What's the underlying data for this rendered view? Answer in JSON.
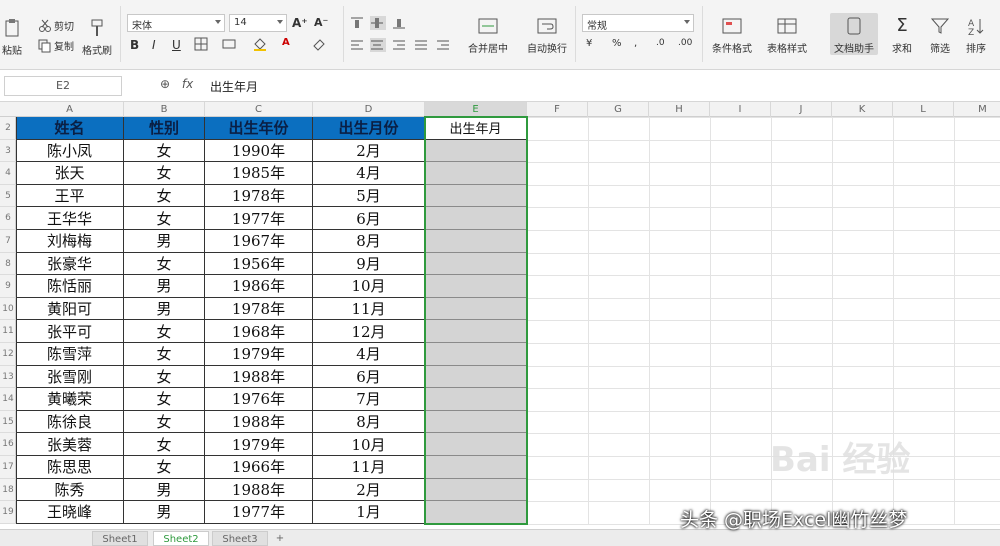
{
  "ribbon": {
    "paste": "粘贴",
    "cut": "剪切",
    "copy": "复制",
    "format_painter": "格式刷",
    "font_name": "宋体",
    "font_size": "14",
    "merge_center": "合并居中",
    "wrap_text": "自动换行",
    "number_format": "常规",
    "conditional_format": "条件格式",
    "table_style": "表格样式",
    "doc_helper": "文档助手",
    "sum": "求和",
    "filter": "筛选",
    "sort": "排序"
  },
  "formula_bar": {
    "name_box": "E2",
    "fx": "fx",
    "value": "出生年月"
  },
  "columns": [
    "A",
    "B",
    "C",
    "D",
    "E",
    "F",
    "G",
    "H",
    "I",
    "J",
    "K",
    "L",
    "M"
  ],
  "rows": [
    "2",
    "3",
    "4",
    "5",
    "6",
    "7",
    "8",
    "9",
    "10",
    "11",
    "12",
    "13",
    "14",
    "15",
    "16",
    "17",
    "18",
    "19"
  ],
  "table": {
    "headers": [
      "姓名",
      "性别",
      "出生年份",
      "出生月份",
      "出生年月"
    ],
    "rows": [
      [
        "陈小凤",
        "女",
        "1990年",
        "2月"
      ],
      [
        "张天",
        "女",
        "1985年",
        "4月"
      ],
      [
        "王平",
        "女",
        "1978年",
        "5月"
      ],
      [
        "王华华",
        "女",
        "1977年",
        "6月"
      ],
      [
        "刘梅梅",
        "男",
        "1967年",
        "8月"
      ],
      [
        "张豪华",
        "女",
        "1956年",
        "9月"
      ],
      [
        "陈恬丽",
        "男",
        "1986年",
        "10月"
      ],
      [
        "黄阳可",
        "男",
        "1978年",
        "11月"
      ],
      [
        "张平可",
        "女",
        "1968年",
        "12月"
      ],
      [
        "陈雪萍",
        "女",
        "1979年",
        "4月"
      ],
      [
        "张雪刚",
        "女",
        "1988年",
        "6月"
      ],
      [
        "黄曦荣",
        "女",
        "1976年",
        "7月"
      ],
      [
        "陈徐良",
        "女",
        "1988年",
        "8月"
      ],
      [
        "张美蓉",
        "女",
        "1979年",
        "10月"
      ],
      [
        "陈思思",
        "女",
        "1966年",
        "11月"
      ],
      [
        "陈秀",
        "男",
        "1988年",
        "2月"
      ],
      [
        "王晓峰",
        "男",
        "1977年",
        "1月"
      ]
    ]
  },
  "sheets": [
    "Sheet1",
    "Sheet2",
    "Sheet3"
  ],
  "active_sheet": "Sheet2",
  "add_sheet": "+",
  "watermark": "头条 @职场Excel幽竹丝梦",
  "baidu_mark": "Bai 经验",
  "colors": {
    "header_fill": "#0b6fc0",
    "selection": "#2f9a3e",
    "empty_fill": "#d4d4d4"
  }
}
